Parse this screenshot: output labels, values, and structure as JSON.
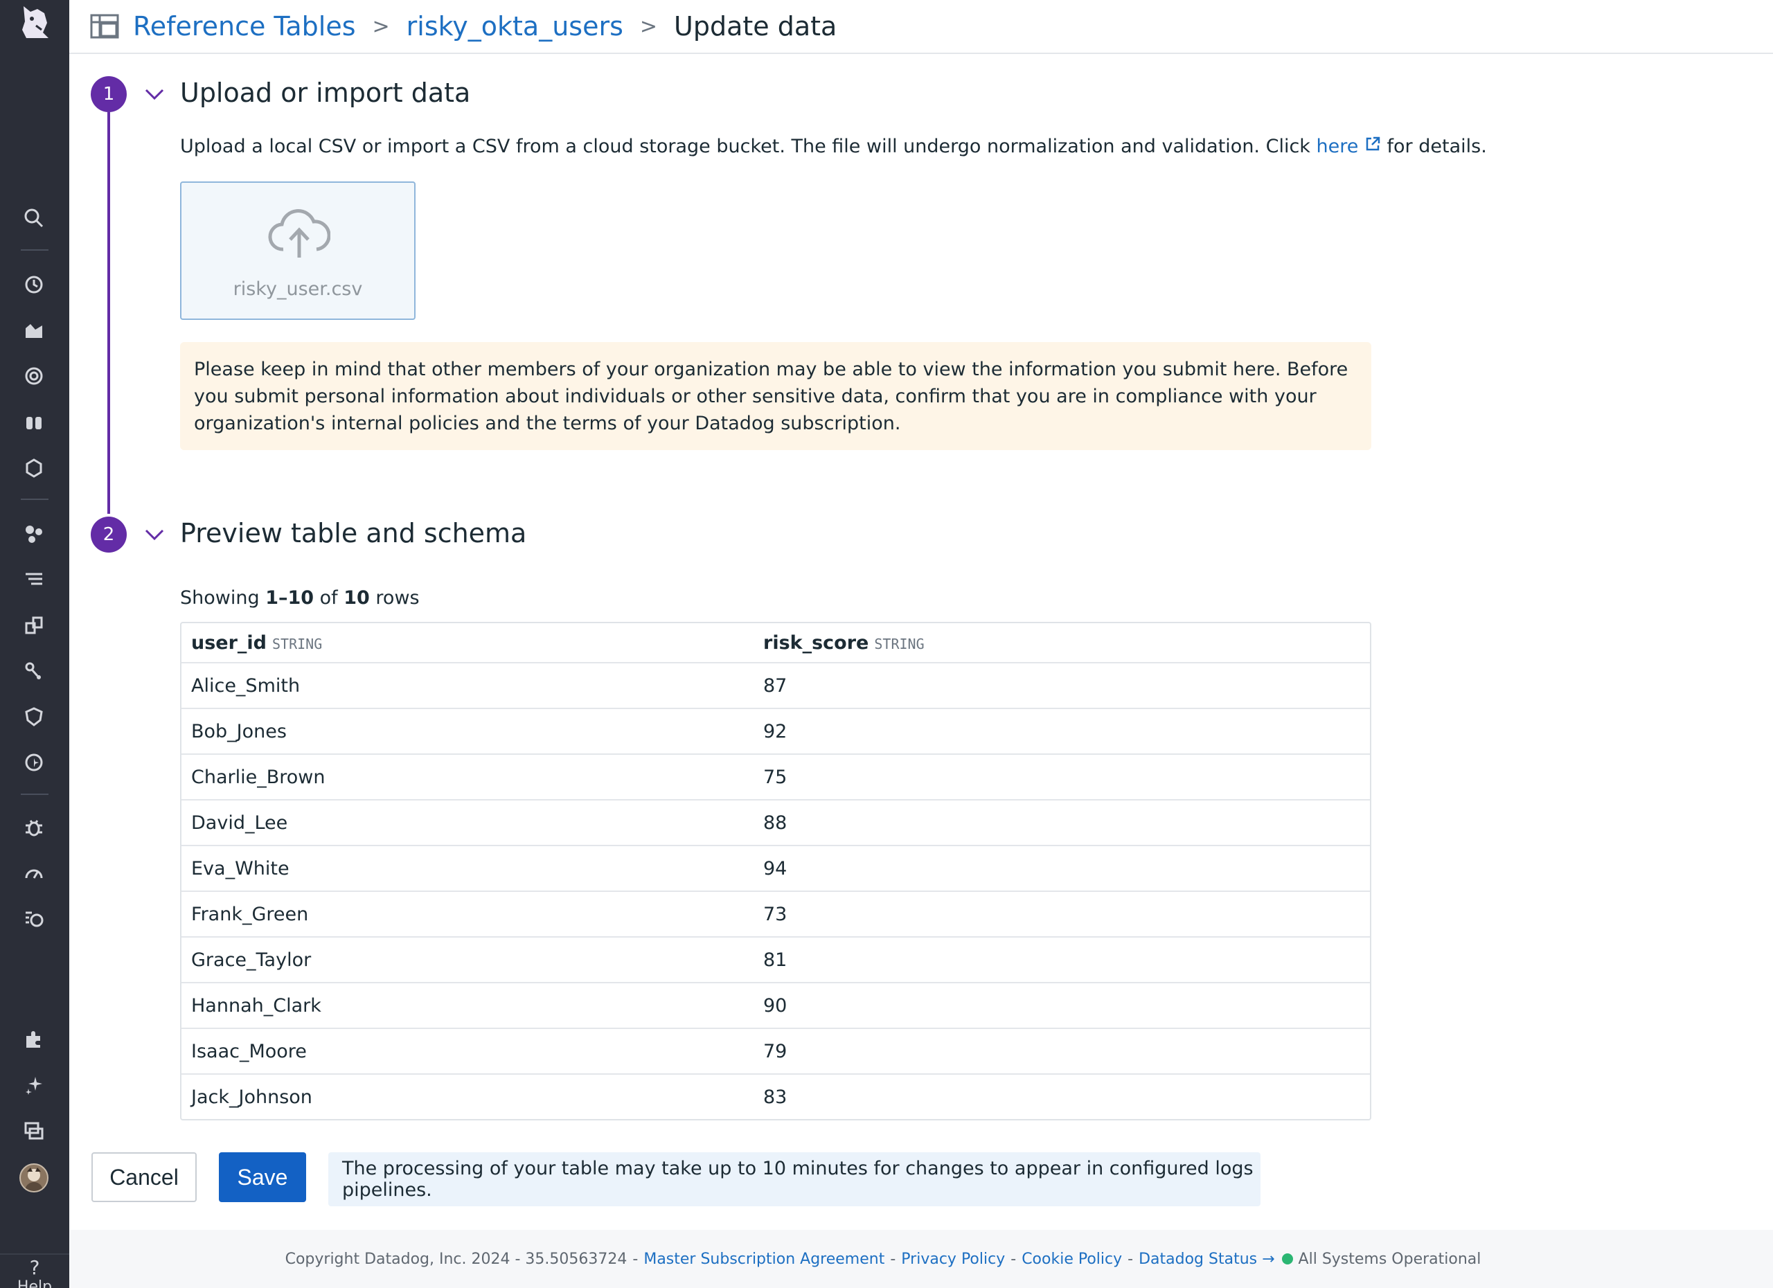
{
  "breadcrumb": {
    "items": [
      "Reference Tables",
      "risky_okta_users"
    ],
    "current": "Update data",
    "separator": ">"
  },
  "steps": [
    {
      "number": "1",
      "title": "Upload or import data"
    },
    {
      "number": "2",
      "title": "Preview table and schema"
    }
  ],
  "upload": {
    "description_prefix": "Upload a local CSV or import a CSV from a cloud storage bucket. The file will undergo normalization and validation. Click ",
    "link_text": "here",
    "description_suffix": " for details.",
    "file_name": "risky_user.csv",
    "warning": "Please keep in mind that other members of your organization may be able to view the information you submit here. Before you submit personal information about individuals or other sensitive data, confirm that you are in compliance with your organization's internal policies and the terms of your Datadog subscription."
  },
  "preview": {
    "showing_prefix": "Showing ",
    "range": "1–10",
    "of": " of ",
    "total": "10",
    "rows_suffix": " rows",
    "columns": [
      {
        "name": "user_id",
        "type": "STRING"
      },
      {
        "name": "risk_score",
        "type": "STRING"
      }
    ],
    "rows": [
      [
        "Alice_Smith",
        "87"
      ],
      [
        "Bob_Jones",
        "92"
      ],
      [
        "Charlie_Brown",
        "75"
      ],
      [
        "David_Lee",
        "88"
      ],
      [
        "Eva_White",
        "94"
      ],
      [
        "Frank_Green",
        "73"
      ],
      [
        "Grace_Taylor",
        "81"
      ],
      [
        "Hannah_Clark",
        "90"
      ],
      [
        "Isaac_Moore",
        "79"
      ],
      [
        "Jack_Johnson",
        "83"
      ]
    ]
  },
  "actions": {
    "cancel_label": "Cancel",
    "save_label": "Save",
    "notice": "The processing of your table may take up to 10 minutes for changes to appear in configured logs pipelines."
  },
  "footer": {
    "copyright": "Copyright Datadog, Inc. 2024 - 35.50563724",
    "links": [
      "Master Subscription Agreement",
      "Privacy Policy",
      "Cookie Policy",
      "Datadog Status →"
    ],
    "status": "All Systems Operational"
  },
  "sidebar": {
    "help_label": "Help",
    "icons": [
      "datadog-logo-icon",
      "search-icon",
      "history-icon",
      "dashboards-icon",
      "monitors-icon",
      "watchdog-icon",
      "integrations-icon",
      "infrastructure-icon",
      "logs-icon",
      "apm-icon",
      "security-icon",
      "synthetics-icon",
      "bug-icon",
      "performance-icon",
      "digital-experience-icon",
      "extensions-icon",
      "ai-icon",
      "workspace-icon"
    ]
  },
  "colors": {
    "sidebar_bg": "#2b2e38",
    "link": "#1d6fc2",
    "step_purple": "#632ca6",
    "save_blue": "#1361c4",
    "warning_bg": "#fef5e7",
    "notice_bg": "#ebf3fb",
    "status_green": "#2bb673"
  }
}
